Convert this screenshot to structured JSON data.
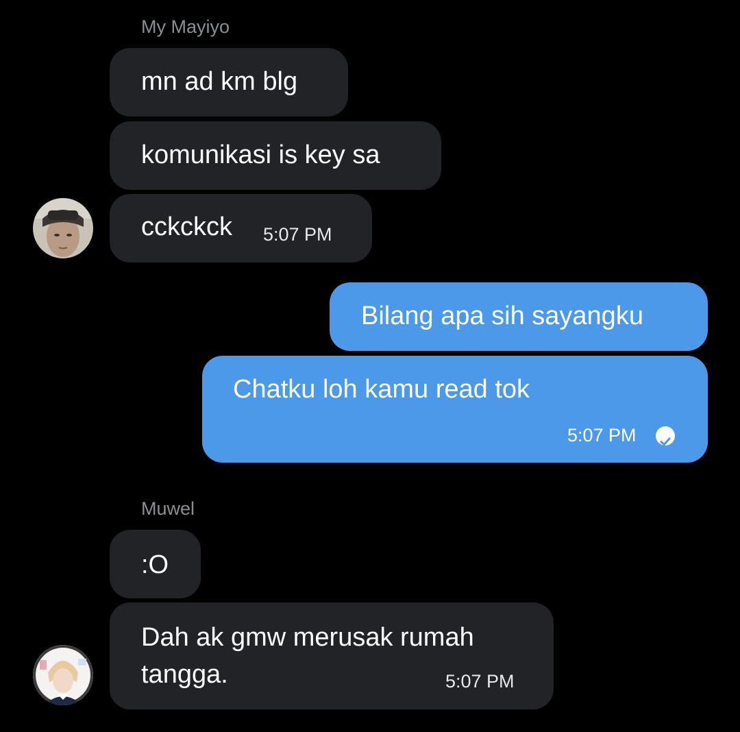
{
  "conversation": {
    "groups": [
      {
        "sender": "My Mayiyo",
        "messages": [
          {
            "text": "mn ad km blg"
          },
          {
            "text": "komunikasi is key sa"
          },
          {
            "text": "cckckck",
            "time": "5:07 PM"
          }
        ],
        "avatar_icon": "user-avatar-photo-icon"
      },
      {
        "sender": "",
        "outgoing": true,
        "messages": [
          {
            "text": "Bilang apa sih sayangku"
          },
          {
            "text": "Chatku loh kamu read tok",
            "time": "5:07 PM",
            "status_icon": "read-check-icon"
          }
        ]
      },
      {
        "sender": "Muwel",
        "messages": [
          {
            "text": ":O"
          },
          {
            "text": "Dah ak gmw merusak rumah tangga.",
            "time": "5:07 PM"
          }
        ],
        "avatar_icon": "user-avatar-photo-icon"
      }
    ]
  },
  "colors": {
    "background": "#000000",
    "incoming_bubble": "#222326",
    "outgoing_bubble": "#4b99e8",
    "sender_name": "#8b8f94"
  }
}
